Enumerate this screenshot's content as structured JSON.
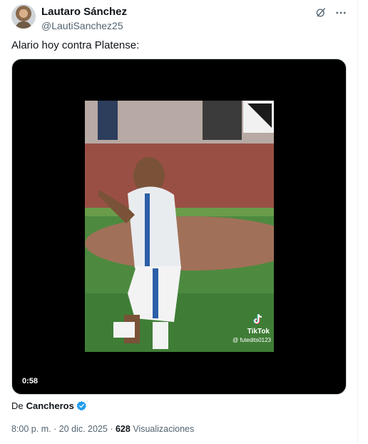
{
  "author": {
    "name": "Lautaro Sánchez",
    "handle": "@LautiSanchez25"
  },
  "icons": {
    "grok": "grok-icon",
    "more": "more-horizontal-icon",
    "verified": "verified-badge-icon",
    "tiktok": "tiktok-logo-icon"
  },
  "tweet": {
    "text": "Alario hoy contra Platense:"
  },
  "media": {
    "duration": "0:58",
    "watermark_brand": "TikTok",
    "watermark_user": "@ futedits0123"
  },
  "source": {
    "prefix": "De",
    "account": "Cancheros"
  },
  "meta": {
    "time": "8:00 p. m.",
    "separator": "·",
    "date": "20 dic. 2025",
    "views_count": "628",
    "views_label": "Visualizaciones"
  },
  "colors": {
    "text_primary": "#0f1419",
    "text_secondary": "#536471",
    "verified": "#1d9bf0",
    "media_bg": "#000000"
  }
}
